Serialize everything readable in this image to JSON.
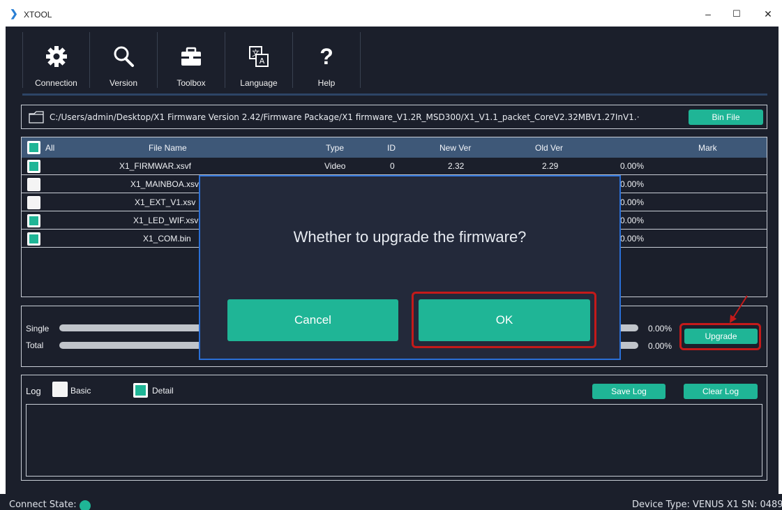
{
  "app": {
    "title": "XTOOL",
    "minimize": "–",
    "maximize": "☐",
    "close": "✕"
  },
  "toolbar": {
    "items": [
      {
        "label": "Connection",
        "icon": "gear-icon"
      },
      {
        "label": "Version",
        "icon": "search-icon"
      },
      {
        "label": "Toolbox",
        "icon": "toolbox-icon"
      },
      {
        "label": "Language",
        "icon": "language-icon"
      },
      {
        "label": "Help",
        "icon": "help-icon"
      }
    ]
  },
  "file": {
    "path": "C:/Users/admin/Desktop/X1 Firmware Version 2.42/Firmware Package/X1 firmware_V1.2R_MSD300/X1_V1.1_packet_CoreV2.32MBV1.27InV1.·",
    "bin_file_label": "Bin File"
  },
  "table": {
    "headers": {
      "all": "All",
      "file_name": "File Name",
      "type": "Type",
      "id": "ID",
      "new_ver": "New Ver",
      "old_ver": "Old Ver",
      "mark": "Mark"
    },
    "rows": [
      {
        "checked": true,
        "file_name": "X1_FIRMWAR.xsvf",
        "type": "Video",
        "id": "0",
        "new_ver": "2.32",
        "old_ver": "2.29",
        "progress": "0.00%"
      },
      {
        "checked": false,
        "file_name": "X1_MAINBOA.xsv",
        "type": "",
        "id": "",
        "new_ver": "",
        "old_ver": "",
        "progress": "0.00%"
      },
      {
        "checked": false,
        "file_name": "X1_EXT_V1.xsv",
        "type": "",
        "id": "",
        "new_ver": "",
        "old_ver": "",
        "progress": "0.00%"
      },
      {
        "checked": true,
        "file_name": "X1_LED_WIF.xsv",
        "type": "",
        "id": "",
        "new_ver": "",
        "old_ver": "",
        "progress": "0.00%"
      },
      {
        "checked": true,
        "file_name": "X1_COM.bin",
        "type": "",
        "id": "",
        "new_ver": "",
        "old_ver": "",
        "progress": "0.00%"
      }
    ]
  },
  "progress": {
    "single_label": "Single",
    "single_pct": "0.00%",
    "single_value": 0,
    "total_label": "Total",
    "total_pct": "0.00%",
    "total_value": 0,
    "upgrade_label": "Upgrade"
  },
  "log": {
    "label": "Log",
    "basic_label": "Basic",
    "basic_checked": false,
    "detail_label": "Detail",
    "detail_checked": true,
    "save_label": "Save Log",
    "clear_label": "Clear Log",
    "content": ""
  },
  "status": {
    "connect_label": "Connect State:",
    "connect_color": "#1fb596",
    "device_info": "Device Type: VENUS X1 SN: 0489"
  },
  "dialog": {
    "message": "Whether to upgrade the firmware?",
    "cancel_label": "Cancel",
    "ok_label": "OK"
  },
  "colors": {
    "accent": "#1fb596",
    "background": "#1b1f2b",
    "header": "#3e5878",
    "highlight": "#c41a1a",
    "dialog_border": "#2a6fd6"
  }
}
